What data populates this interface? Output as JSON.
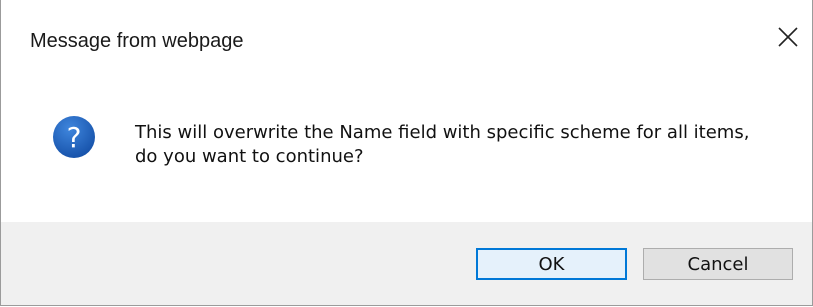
{
  "dialog": {
    "title": "Message from webpage",
    "message": "This will overwrite the Name field with specific scheme for all items, do you want to continue?",
    "icon": "question-icon",
    "close_icon": "close-icon"
  },
  "buttons": {
    "ok_label": "OK",
    "cancel_label": "Cancel"
  },
  "colors": {
    "accent": "#0078d7",
    "icon_blue": "#1f5fbf",
    "footer_bg": "#f0f0f0"
  }
}
